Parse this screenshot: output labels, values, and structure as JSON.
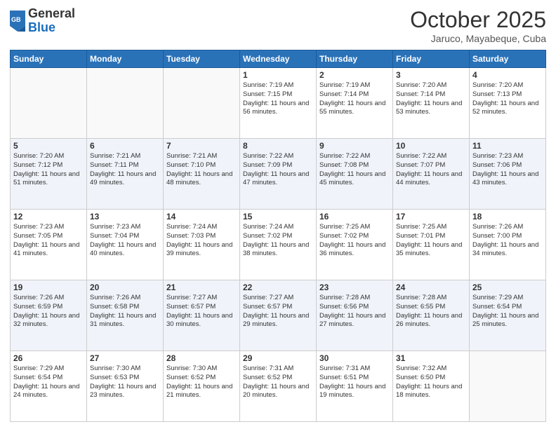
{
  "header": {
    "logo_general": "General",
    "logo_blue": "Blue",
    "month_title": "October 2025",
    "location": "Jaruco, Mayabeque, Cuba"
  },
  "weekdays": [
    "Sunday",
    "Monday",
    "Tuesday",
    "Wednesday",
    "Thursday",
    "Friday",
    "Saturday"
  ],
  "weeks": [
    [
      {
        "day": "",
        "info": ""
      },
      {
        "day": "",
        "info": ""
      },
      {
        "day": "",
        "info": ""
      },
      {
        "day": "1",
        "info": "Sunrise: 7:19 AM\nSunset: 7:15 PM\nDaylight: 11 hours and 56 minutes."
      },
      {
        "day": "2",
        "info": "Sunrise: 7:19 AM\nSunset: 7:14 PM\nDaylight: 11 hours and 55 minutes."
      },
      {
        "day": "3",
        "info": "Sunrise: 7:20 AM\nSunset: 7:14 PM\nDaylight: 11 hours and 53 minutes."
      },
      {
        "day": "4",
        "info": "Sunrise: 7:20 AM\nSunset: 7:13 PM\nDaylight: 11 hours and 52 minutes."
      }
    ],
    [
      {
        "day": "5",
        "info": "Sunrise: 7:20 AM\nSunset: 7:12 PM\nDaylight: 11 hours and 51 minutes."
      },
      {
        "day": "6",
        "info": "Sunrise: 7:21 AM\nSunset: 7:11 PM\nDaylight: 11 hours and 49 minutes."
      },
      {
        "day": "7",
        "info": "Sunrise: 7:21 AM\nSunset: 7:10 PM\nDaylight: 11 hours and 48 minutes."
      },
      {
        "day": "8",
        "info": "Sunrise: 7:22 AM\nSunset: 7:09 PM\nDaylight: 11 hours and 47 minutes."
      },
      {
        "day": "9",
        "info": "Sunrise: 7:22 AM\nSunset: 7:08 PM\nDaylight: 11 hours and 45 minutes."
      },
      {
        "day": "10",
        "info": "Sunrise: 7:22 AM\nSunset: 7:07 PM\nDaylight: 11 hours and 44 minutes."
      },
      {
        "day": "11",
        "info": "Sunrise: 7:23 AM\nSunset: 7:06 PM\nDaylight: 11 hours and 43 minutes."
      }
    ],
    [
      {
        "day": "12",
        "info": "Sunrise: 7:23 AM\nSunset: 7:05 PM\nDaylight: 11 hours and 41 minutes."
      },
      {
        "day": "13",
        "info": "Sunrise: 7:23 AM\nSunset: 7:04 PM\nDaylight: 11 hours and 40 minutes."
      },
      {
        "day": "14",
        "info": "Sunrise: 7:24 AM\nSunset: 7:03 PM\nDaylight: 11 hours and 39 minutes."
      },
      {
        "day": "15",
        "info": "Sunrise: 7:24 AM\nSunset: 7:02 PM\nDaylight: 11 hours and 38 minutes."
      },
      {
        "day": "16",
        "info": "Sunrise: 7:25 AM\nSunset: 7:02 PM\nDaylight: 11 hours and 36 minutes."
      },
      {
        "day": "17",
        "info": "Sunrise: 7:25 AM\nSunset: 7:01 PM\nDaylight: 11 hours and 35 minutes."
      },
      {
        "day": "18",
        "info": "Sunrise: 7:26 AM\nSunset: 7:00 PM\nDaylight: 11 hours and 34 minutes."
      }
    ],
    [
      {
        "day": "19",
        "info": "Sunrise: 7:26 AM\nSunset: 6:59 PM\nDaylight: 11 hours and 32 minutes."
      },
      {
        "day": "20",
        "info": "Sunrise: 7:26 AM\nSunset: 6:58 PM\nDaylight: 11 hours and 31 minutes."
      },
      {
        "day": "21",
        "info": "Sunrise: 7:27 AM\nSunset: 6:57 PM\nDaylight: 11 hours and 30 minutes."
      },
      {
        "day": "22",
        "info": "Sunrise: 7:27 AM\nSunset: 6:57 PM\nDaylight: 11 hours and 29 minutes."
      },
      {
        "day": "23",
        "info": "Sunrise: 7:28 AM\nSunset: 6:56 PM\nDaylight: 11 hours and 27 minutes."
      },
      {
        "day": "24",
        "info": "Sunrise: 7:28 AM\nSunset: 6:55 PM\nDaylight: 11 hours and 26 minutes."
      },
      {
        "day": "25",
        "info": "Sunrise: 7:29 AM\nSunset: 6:54 PM\nDaylight: 11 hours and 25 minutes."
      }
    ],
    [
      {
        "day": "26",
        "info": "Sunrise: 7:29 AM\nSunset: 6:54 PM\nDaylight: 11 hours and 24 minutes."
      },
      {
        "day": "27",
        "info": "Sunrise: 7:30 AM\nSunset: 6:53 PM\nDaylight: 11 hours and 23 minutes."
      },
      {
        "day": "28",
        "info": "Sunrise: 7:30 AM\nSunset: 6:52 PM\nDaylight: 11 hours and 21 minutes."
      },
      {
        "day": "29",
        "info": "Sunrise: 7:31 AM\nSunset: 6:52 PM\nDaylight: 11 hours and 20 minutes."
      },
      {
        "day": "30",
        "info": "Sunrise: 7:31 AM\nSunset: 6:51 PM\nDaylight: 11 hours and 19 minutes."
      },
      {
        "day": "31",
        "info": "Sunrise: 7:32 AM\nSunset: 6:50 PM\nDaylight: 11 hours and 18 minutes."
      },
      {
        "day": "",
        "info": ""
      }
    ]
  ]
}
